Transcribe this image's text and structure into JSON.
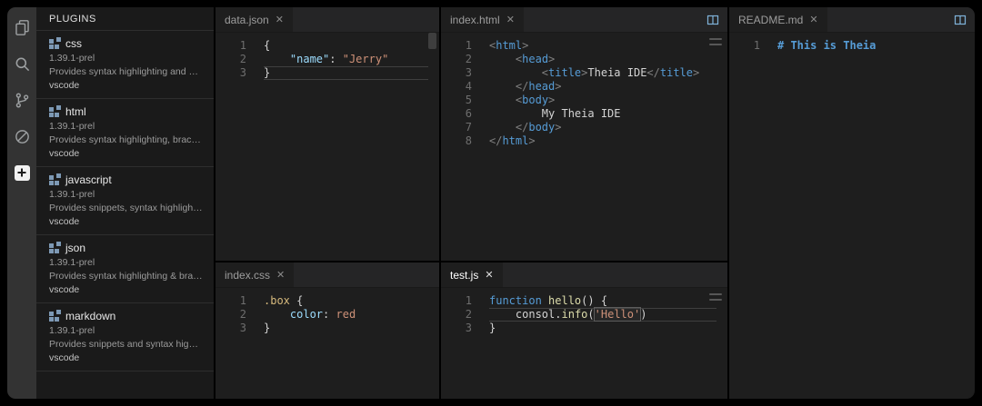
{
  "icons": {
    "close": "✕"
  },
  "theme": {
    "frame_bg": "#000000",
    "activity_bar_bg": "#333333",
    "sidebar_bg": "#1a1a1a",
    "editor_bg": "#1e1e1e",
    "tabbar_bg": "#252526",
    "tab_active_bg": "#1e1e1e",
    "tab_text": "#9d9d9d",
    "tab_text_focused": "#ffffff",
    "line_number": "#6e6e6e",
    "separator": "#2e2e2e",
    "current_line_border": "#3f3f3f",
    "icon": "#9da0a2",
    "accent_split_icon": "#7fb2d9",
    "tok_fg": "#d4d4d4",
    "tok_tag": "#569cd6",
    "tok_punct": "#808080",
    "tok_str": "#ce9178",
    "tok_prop": "#9cdcfe",
    "tok_kw": "#569cd6",
    "tok_fn": "#dcdcaa",
    "tok_sel": "#d7ba7d",
    "tok_val": "#ce9178",
    "tok_md": "#569cd6"
  },
  "activity_bar": {
    "items": [
      {
        "id": "explorer",
        "icon": "files-icon",
        "active": false
      },
      {
        "id": "search",
        "icon": "search-icon",
        "active": false
      },
      {
        "id": "source-control",
        "icon": "git-branch-icon",
        "active": false
      },
      {
        "id": "debug",
        "icon": "debug-disabled-icon",
        "active": false
      },
      {
        "id": "plugins",
        "icon": "plugins-icon",
        "active": true
      }
    ]
  },
  "sidebar": {
    "title": "PLUGINS",
    "plugins": [
      {
        "name": "css",
        "version": "1.39.1-prel",
        "description": "Provides syntax highlighting and bracket ...",
        "publisher": "vscode"
      },
      {
        "name": "html",
        "version": "1.39.1-prel",
        "description": "Provides syntax highlighting, bracket mat...",
        "publisher": "vscode"
      },
      {
        "name": "javascript",
        "version": "1.39.1-prel",
        "description": "Provides snippets, syntax highlighting, br...",
        "publisher": "vscode"
      },
      {
        "name": "json",
        "version": "1.39.1-prel",
        "description": "Provides syntax highlighting & bracket ma...",
        "publisher": "vscode"
      },
      {
        "name": "markdown",
        "version": "1.39.1-prel",
        "description": "Provides snippets and syntax highlighting...",
        "publisher": "vscode"
      }
    ]
  },
  "editors": [
    {
      "id": "data-json",
      "tab": "data.json",
      "focused": false,
      "current_line": 3,
      "lines": [
        [
          [
            "{",
            "fg"
          ]
        ],
        [
          [
            "    ",
            "fg"
          ],
          [
            "\"name\"",
            "prop"
          ],
          [
            ":",
            "fg"
          ],
          [
            " ",
            "fg"
          ],
          [
            "\"Jerry\"",
            "str"
          ]
        ],
        [
          [
            "}",
            "fg"
          ]
        ]
      ]
    },
    {
      "id": "index-html",
      "tab": "index.html",
      "focused": false,
      "current_line": null,
      "actions": [
        "split-editor"
      ],
      "lines": [
        [
          [
            "<",
            "punct"
          ],
          [
            "html",
            "tag"
          ],
          [
            ">",
            "punct"
          ]
        ],
        [
          [
            "    ",
            "fg"
          ],
          [
            "<",
            "punct"
          ],
          [
            "head",
            "tag"
          ],
          [
            ">",
            "punct"
          ]
        ],
        [
          [
            "        ",
            "fg"
          ],
          [
            "<",
            "punct"
          ],
          [
            "title",
            "tag"
          ],
          [
            ">",
            "punct"
          ],
          [
            "Theia IDE",
            "fg"
          ],
          [
            "</",
            "punct"
          ],
          [
            "title",
            "tag"
          ],
          [
            ">",
            "punct"
          ]
        ],
        [
          [
            "    ",
            "fg"
          ],
          [
            "</",
            "punct"
          ],
          [
            "head",
            "tag"
          ],
          [
            ">",
            "punct"
          ]
        ],
        [
          [
            "    ",
            "fg"
          ],
          [
            "<",
            "punct"
          ],
          [
            "body",
            "tag"
          ],
          [
            ">",
            "punct"
          ]
        ],
        [
          [
            "        My Theia IDE",
            "fg"
          ]
        ],
        [
          [
            "    ",
            "fg"
          ],
          [
            "</",
            "punct"
          ],
          [
            "body",
            "tag"
          ],
          [
            ">",
            "punct"
          ]
        ],
        [
          [
            "</",
            "punct"
          ],
          [
            "html",
            "tag"
          ],
          [
            ">",
            "punct"
          ]
        ]
      ]
    },
    {
      "id": "readme-md",
      "tab": "README.md",
      "focused": false,
      "current_line": null,
      "actions": [
        "split-editor"
      ],
      "lines": [
        [
          [
            "# This is Theia",
            "md"
          ]
        ]
      ]
    },
    {
      "id": "index-css",
      "tab": "index.css",
      "focused": false,
      "current_line": null,
      "lines": [
        [
          [
            ".box",
            "sel"
          ],
          [
            " {",
            "fg"
          ]
        ],
        [
          [
            "    ",
            "fg"
          ],
          [
            "color",
            "prop"
          ],
          [
            ":",
            "fg"
          ],
          [
            " ",
            "fg"
          ],
          [
            "red",
            "val"
          ]
        ],
        [
          [
            "}",
            "fg"
          ]
        ]
      ]
    },
    {
      "id": "test-js",
      "tab": "test.js",
      "focused": true,
      "current_line": 2,
      "lines": [
        [
          [
            "function",
            "kw"
          ],
          [
            " ",
            "fg"
          ],
          [
            "hello",
            "fn"
          ],
          [
            "() {",
            "fg"
          ]
        ],
        [
          [
            "    ",
            "fg"
          ],
          [
            "consol",
            "fg"
          ],
          [
            ".",
            "fg"
          ],
          [
            "info",
            "fn"
          ],
          [
            "(",
            "fg"
          ],
          [
            "'Hello'",
            "str occ"
          ],
          [
            ")",
            "fg"
          ]
        ],
        [
          [
            "}",
            "fg"
          ]
        ]
      ]
    }
  ]
}
